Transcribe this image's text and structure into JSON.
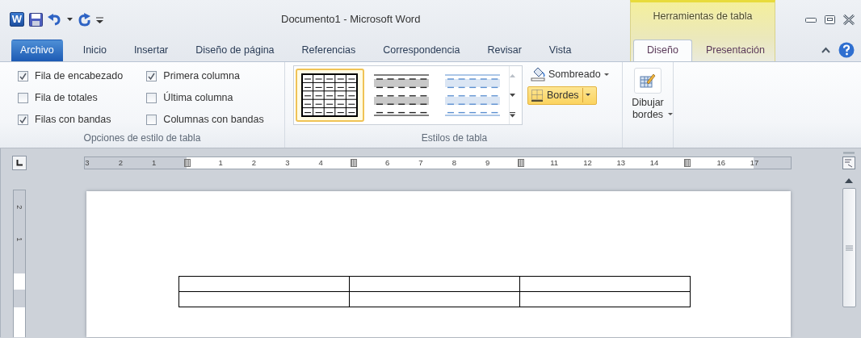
{
  "window": {
    "title": "Documento1 - Microsoft Word",
    "app_letter": "W"
  },
  "tabs": [
    {
      "label": "Archivo",
      "kind": "file",
      "selected": false
    },
    {
      "label": "Inicio",
      "kind": "tab",
      "selected": false
    },
    {
      "label": "Insertar",
      "kind": "tab",
      "selected": false
    },
    {
      "label": "Diseño de página",
      "kind": "tab",
      "selected": false
    },
    {
      "label": "Referencias",
      "kind": "tab",
      "selected": false
    },
    {
      "label": "Correspondencia",
      "kind": "tab",
      "selected": false
    },
    {
      "label": "Revisar",
      "kind": "tab",
      "selected": false
    },
    {
      "label": "Vista",
      "kind": "tab",
      "selected": false
    }
  ],
  "contextual_tabs": {
    "label": "Herramientas de tabla",
    "tabs": [
      {
        "label": "Diseño",
        "selected": true
      },
      {
        "label": "Presentación",
        "selected": false
      }
    ]
  },
  "table_style_options": {
    "label": "Opciones de estilo de tabla",
    "options": [
      {
        "label": "Fila de encabezado",
        "checked": true
      },
      {
        "label": "Fila de totales",
        "checked": false
      },
      {
        "label": "Filas con bandas",
        "checked": true
      },
      {
        "label": "Primera columna",
        "checked": true
      },
      {
        "label": "Última columna",
        "checked": false
      },
      {
        "label": "Columnas con bandas",
        "checked": false
      }
    ]
  },
  "table_styles": {
    "label": "Estilos de tabla",
    "styles": [
      {
        "kind": "grid",
        "selected": true
      },
      {
        "kind": "banded-gray",
        "selected": false
      },
      {
        "kind": "banded-blue",
        "selected": false
      }
    ]
  },
  "shading": {
    "label": "Sombreado"
  },
  "borders": {
    "label": "Bordes",
    "highlighted": true
  },
  "draw_borders": {
    "label": "Dibujar bordes"
  },
  "ruler": {
    "marks": [
      {
        "kind": "number",
        "label": "3"
      },
      {
        "kind": "number",
        "label": "2"
      },
      {
        "kind": "number",
        "label": "1"
      },
      {
        "kind": "margin"
      },
      {
        "kind": "number",
        "label": "1"
      },
      {
        "kind": "number",
        "label": "2"
      },
      {
        "kind": "number",
        "label": "3"
      },
      {
        "kind": "number",
        "label": "4"
      },
      {
        "kind": "column"
      },
      {
        "kind": "number",
        "label": "6"
      },
      {
        "kind": "number",
        "label": "7"
      },
      {
        "kind": "number",
        "label": "8"
      },
      {
        "kind": "number",
        "label": "9"
      },
      {
        "kind": "column"
      },
      {
        "kind": "number",
        "label": "11"
      },
      {
        "kind": "number",
        "label": "12"
      },
      {
        "kind": "number",
        "label": "13"
      },
      {
        "kind": "number",
        "label": "14"
      },
      {
        "kind": "column"
      },
      {
        "kind": "number",
        "label": "16"
      },
      {
        "kind": "number",
        "label": "17"
      }
    ]
  },
  "vertical_ruler": {
    "labels": [
      "2",
      "1"
    ]
  }
}
